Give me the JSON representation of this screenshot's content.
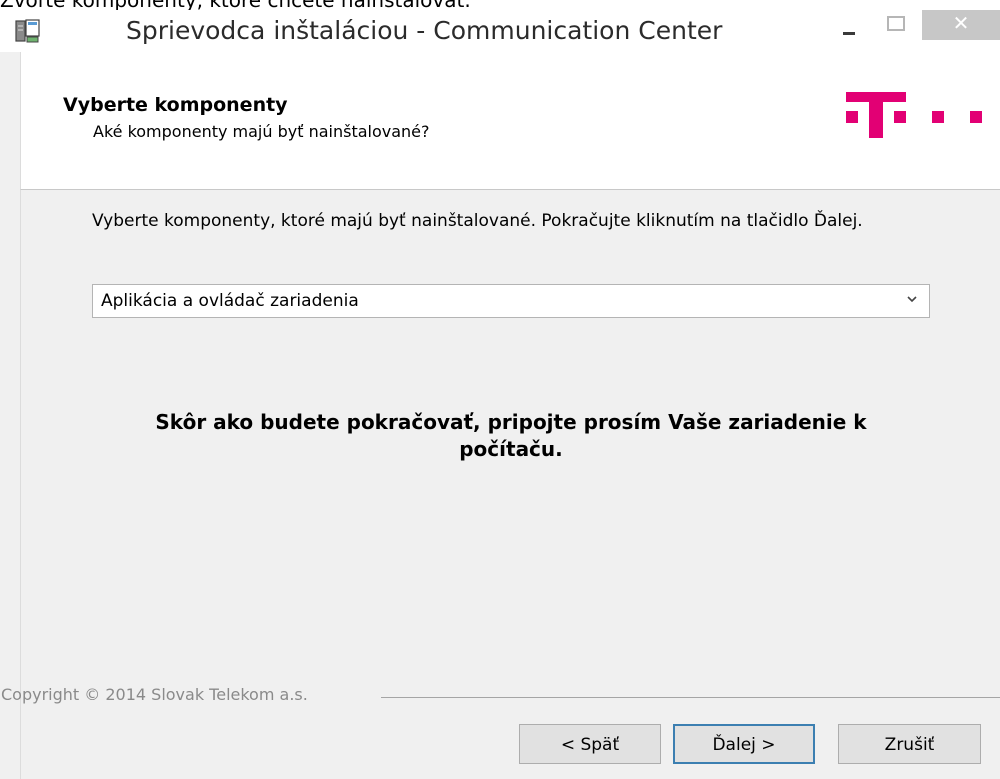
{
  "background": {
    "caption": "Zvoľte komponenty, ktoré chcete nainštalovať."
  },
  "window": {
    "title": "Sprievodca inštaláciou - Communication Center",
    "close_glyph": "✕"
  },
  "header": {
    "title": "Vyberte komponenty",
    "subtitle": "Aké komponenty majú byť nainštalované?",
    "brand_color": "#e20074"
  },
  "content": {
    "instruction": "Vyberte komponenty, ktoré majú byť nainštalované. Pokračujte kliknutím na tlačidlo Ďalej.",
    "components_select": {
      "selected": "Aplikácia a ovládač zariadenia"
    },
    "notice": "Skôr ako budete pokračovať, pripojte prosím Vaše zariadenie k počítaču."
  },
  "footer": {
    "copyright": "Copyright © 2014 Slovak Telekom a.s.",
    "back_label": "< Späť",
    "next_label": "Ďalej >",
    "cancel_label": "Zrušiť"
  }
}
